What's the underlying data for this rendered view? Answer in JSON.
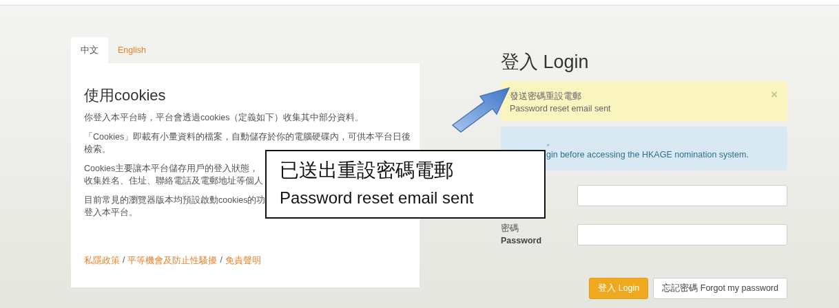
{
  "tabs": [
    {
      "label": "中文",
      "selected": true
    },
    {
      "label": "English",
      "selected": false
    }
  ],
  "cookies": {
    "title": "使用cookies",
    "paragraphs": [
      {
        "lines": [
          "你登入本平台時，平台會透過cookies（定義如下）收集其中部分資料。"
        ]
      },
      {
        "lines": [
          "「Cookies」即載有小量資料的檔案，自動儲存於你的電腦硬碟內，可供本平台日後",
          "檢索。"
        ]
      },
      {
        "lines": [
          "Cookies主要讓本平台儲存用戶的登入狀態，",
          "收集姓名、住址、聯絡電話及電郵地址等個人"
        ]
      },
      {
        "lines": [
          "目前常見的瀏覽器版本均預設啟動cookies的功",
          "登入本平台。"
        ]
      }
    ],
    "links": [
      "私隱政策",
      "平等機會及防止性騷擾",
      "免責聲明"
    ],
    "link_separator": "/"
  },
  "login": {
    "title": "登入 Login",
    "alerts": [
      {
        "kind": "warning",
        "lines": [
          "發送密碼重設電郵",
          "Password reset email sent"
        ],
        "dismissible": true,
        "close": "×"
      },
      {
        "kind": "info",
        "lines": [
          "。",
          "gin before accessing the HKAGE nomination system."
        ]
      }
    ],
    "fields": [
      {
        "label": "密碼",
        "label_en": "Password"
      }
    ],
    "buttons": [
      {
        "label": "登入 Login",
        "kind": "primary"
      },
      {
        "label": "忘記密碼 Forgot my password",
        "kind": "default"
      }
    ]
  },
  "callout": {
    "lines": [
      "已送出重設密碼電郵",
      "Password reset email sent"
    ]
  }
}
